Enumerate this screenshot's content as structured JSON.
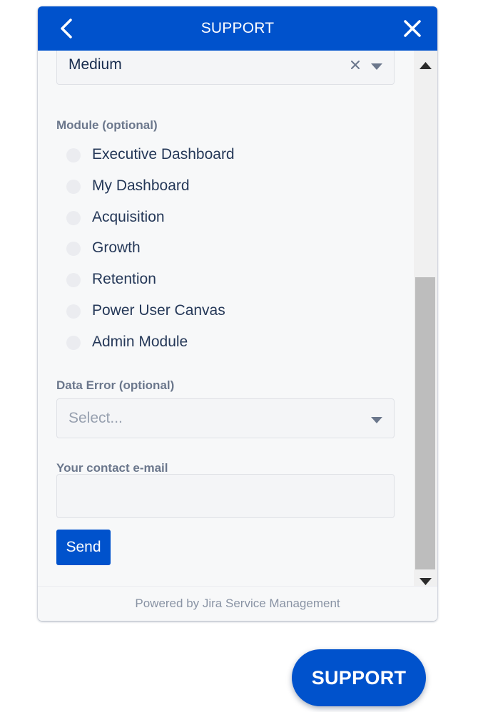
{
  "header": {
    "title": "SUPPORT",
    "back_icon": "chevron-left-icon",
    "close_icon": "close-icon"
  },
  "priority_select": {
    "value": "Medium"
  },
  "module": {
    "label": "Module (optional)",
    "options": [
      "Executive Dashboard",
      "My Dashboard",
      "Acquisition",
      "Growth",
      "Retention",
      "Power User Canvas",
      "Admin Module"
    ]
  },
  "data_error": {
    "label": "Data Error (optional)",
    "placeholder": "Select..."
  },
  "contact_email": {
    "label": "Your contact e-mail",
    "value": ""
  },
  "send_button": {
    "label": "Send"
  },
  "footer": {
    "text": "Powered by Jira Service Management"
  },
  "fab": {
    "label": "SUPPORT"
  },
  "colors": {
    "brand": "#0052cc",
    "text": "#253858",
    "muted_label": "#6b778c",
    "scrollbar_thumb": "#bdbdbd"
  }
}
